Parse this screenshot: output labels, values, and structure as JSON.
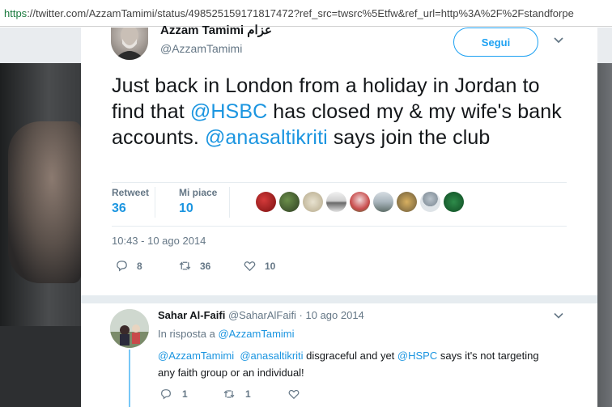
{
  "browser": {
    "url_scheme": "https",
    "url_rest": "://twitter.com/AzzamTamimi/status/498525159171817472?ref_src=twsrc%5Etfw&ref_url=http%3A%2F%2Fstandforpe"
  },
  "tweet": {
    "author_name": "Azzam Tamimi عزام",
    "author_handle": "@AzzamTamimi",
    "follow_label": "Segui",
    "text_1": "Just back in London from a holiday in Jordan to find that ",
    "mention_1": "@HSBC",
    "text_2": " has closed my & my wife's bank accounts. ",
    "mention_2": "@anasaltikriti",
    "text_3": " says join the club",
    "retweet_label": "Retweet",
    "retweet_count": "36",
    "likes_label": "Mi piace",
    "likes_count": "10",
    "timestamp": "10:43 - 10 ago 2014",
    "replies_count": "8",
    "retweets_action_count": "36",
    "likes_action_count": "10"
  },
  "reply": {
    "name": "Sahar Al-Faifi",
    "meta": " @SaharAlFaifi · 10 ago 2014",
    "in_reply_prefix": "In risposta a ",
    "in_reply_mention": "@AzzamTamimi",
    "mention_a": "@AzzamTamimi",
    "mention_b": "@anasaltikriti",
    "text_a": " disgraceful and yet ",
    "mention_c": "@HSPC",
    "text_b": " says it's not targeting any faith group or an individual!",
    "reply_count": "1",
    "retweet_count": "1"
  },
  "colors": {
    "accent": "#1da1f2",
    "mention": "#1b95e0"
  },
  "icons": [
    "reply-icon",
    "retweet-icon",
    "heart-icon",
    "chevron-down-icon"
  ]
}
